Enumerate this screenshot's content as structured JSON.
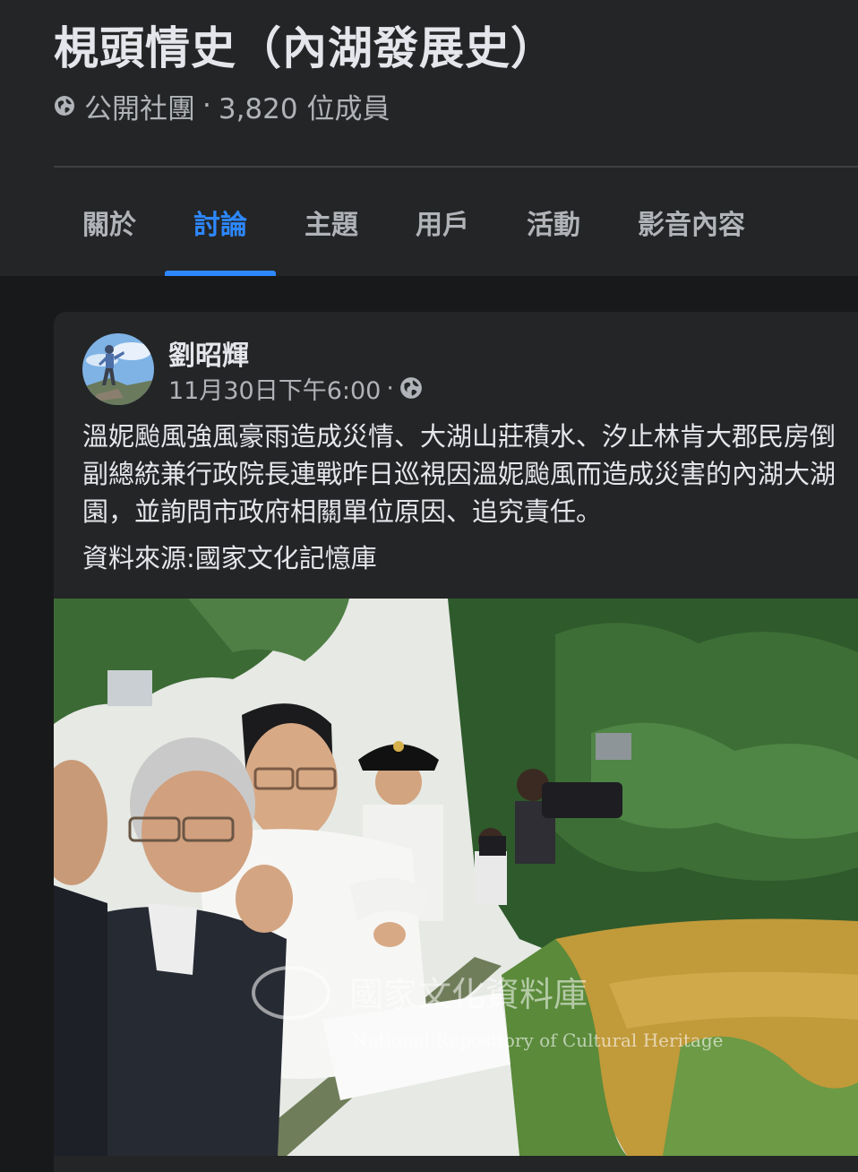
{
  "group": {
    "title": "梘頭情史（內湖發展史）",
    "privacy": "公開社團",
    "separator": "·",
    "members": "3,820 位成員",
    "privacy_icon": "globe-icon"
  },
  "tabs": [
    {
      "label": "關於",
      "active": false
    },
    {
      "label": "討論",
      "active": true
    },
    {
      "label": "主題",
      "active": false
    },
    {
      "label": "用戶",
      "active": false
    },
    {
      "label": "活動",
      "active": false
    },
    {
      "label": "影音內容",
      "active": false
    }
  ],
  "post": {
    "author": "劉昭輝",
    "timestamp": "11月30日下午6:00",
    "separator": "·",
    "audience_icon": "globe-icon",
    "text_lines": [
      "溫妮颱風強風豪雨造成災情、大湖山莊積水、汐止林肯大郡民房倒",
      "副總統兼行政院長連戰昨日巡視因溫妮颱風而造成災害的內湖大湖",
      "園，並詢問市政府相關單位原因、追究責任。"
    ],
    "source": "資料來源:國家文化記憶庫",
    "photo": {
      "watermark_cn": "國家文化資料庫",
      "watermark_en": "National Repository of Cultural Heritage"
    }
  },
  "colors": {
    "background": "#18191a",
    "surface": "#242526",
    "accent": "#2d88ff",
    "text_primary": "#e4e6eb",
    "text_secondary": "#b0b3b8"
  }
}
